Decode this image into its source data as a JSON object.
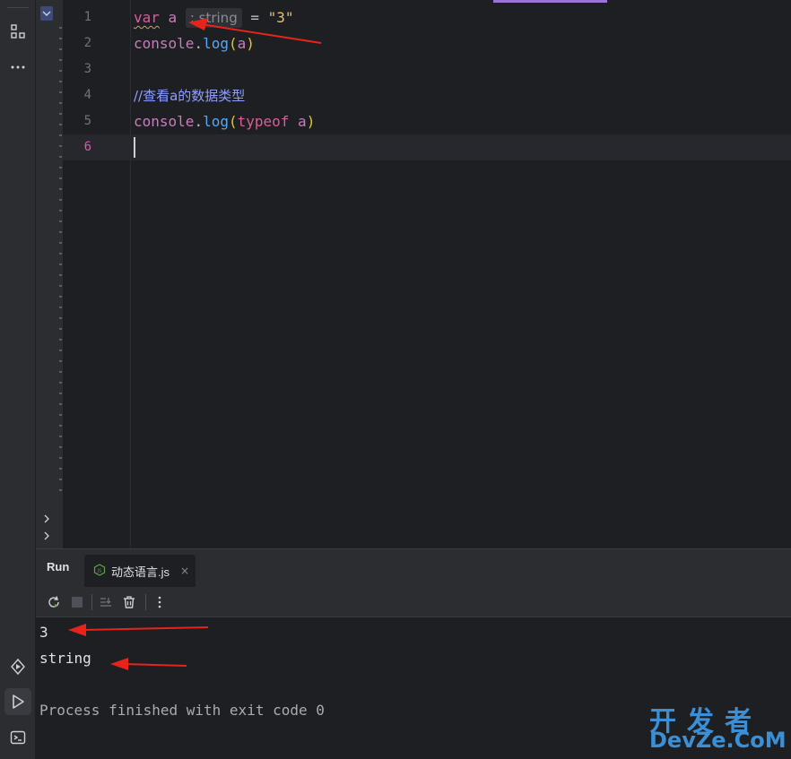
{
  "editor": {
    "lines": [
      {
        "number": "1",
        "kw": "var",
        "name": "a",
        "hint": ": string",
        "rest": " = ",
        "value": "\"3\""
      },
      {
        "number": "2",
        "obj": "console",
        "dot": ".",
        "method": "log",
        "open": "(",
        "arg": "a",
        "close": ")"
      },
      {
        "number": "3"
      },
      {
        "number": "4",
        "comment": "//查看a的数据类型"
      },
      {
        "number": "5",
        "obj": "console",
        "dot": ".",
        "method": "log",
        "open": "(",
        "kw": "typeof",
        "arg": " a",
        "close": ")"
      },
      {
        "number": "6"
      }
    ]
  },
  "run_panel": {
    "title": "Run",
    "tab_label": "动态语言.js",
    "tab_close": "×",
    "output": [
      "3",
      "string",
      "Process finished with exit code 0"
    ]
  },
  "watermark": {
    "cn": "开发者",
    "en": "DevZe.CoM"
  },
  "colors": {
    "accent": "#9c74d6",
    "arrow": "#e8231c",
    "current_line_number": "#d05ea8"
  }
}
